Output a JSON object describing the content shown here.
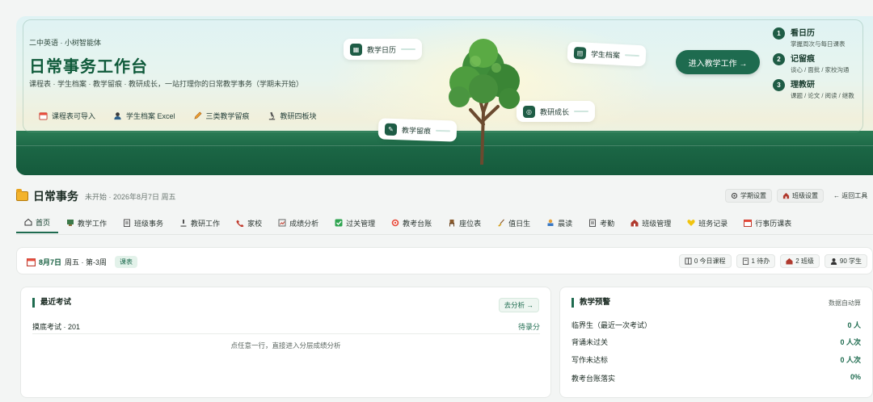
{
  "hero": {
    "eyebrow": "二中英语 · 小树智能体",
    "title": "日常事务工作台",
    "desc": "课程表 · 学生档案 · 教学留痕 · 教研成长，一站打理你的日常教学事务（学期未开始）",
    "features": [
      "课程表可导入",
      "学生档案 Excel",
      "三类教学留痕",
      "教研四板块"
    ],
    "chips": {
      "calendar": "教学日历",
      "archive": "学生档案",
      "growth": "教研成长",
      "traces": "教学留痕"
    },
    "enter_button": "进入教学工作 →",
    "steps": [
      {
        "num": "1",
        "title": "看日历",
        "sub": "掌握周次与每日课表"
      },
      {
        "num": "2",
        "title": "记留痕",
        "sub": "谈心 / 面批 / 家校沟通"
      },
      {
        "num": "3",
        "title": "理教研",
        "sub": "课题 / 论文 / 阅读 / 继教"
      }
    ]
  },
  "header": {
    "title": "日常事务",
    "sub": "未开始 · 2026年8月7日 周五",
    "term_settings": "学期设置",
    "class_settings": "班级设置",
    "back": "← 返回工具"
  },
  "nav": {
    "items": [
      "首页",
      "教学工作",
      "班级事务",
      "教研工作",
      "家校",
      "成绩分析",
      "过关管理",
      "教考台账",
      "座位表",
      "值日生",
      "晨读",
      "考勤",
      "班级管理",
      "班务记录",
      "行事历课表"
    ]
  },
  "datebar": {
    "date": "8月7日",
    "week": "周五 · 第-3周",
    "tag": "课表",
    "stats": [
      "0 今日课程",
      "1 待办",
      "2 班级",
      "90 学生"
    ]
  },
  "exams": {
    "title": "最近考试",
    "goto": "去分析 →",
    "row_name": "摸底考试 · 201",
    "row_status": "待录分",
    "hint": "点任意一行，直接进入分层成绩分析"
  },
  "alerts": {
    "title": "教学预警",
    "auto": "数据自动算",
    "rows": [
      {
        "label": "临界生（最近一次考试）",
        "value": "0 人"
      },
      {
        "label": "背诵未过关",
        "value": "0 人次"
      },
      {
        "label": "写作未达标",
        "value": "0 人次"
      },
      {
        "label": "教考台账落实",
        "value": "0%"
      }
    ]
  },
  "colors": {
    "accent": "#1e6b4f",
    "brand_green": "#0f5a3a",
    "folder": "#f3b32c"
  }
}
